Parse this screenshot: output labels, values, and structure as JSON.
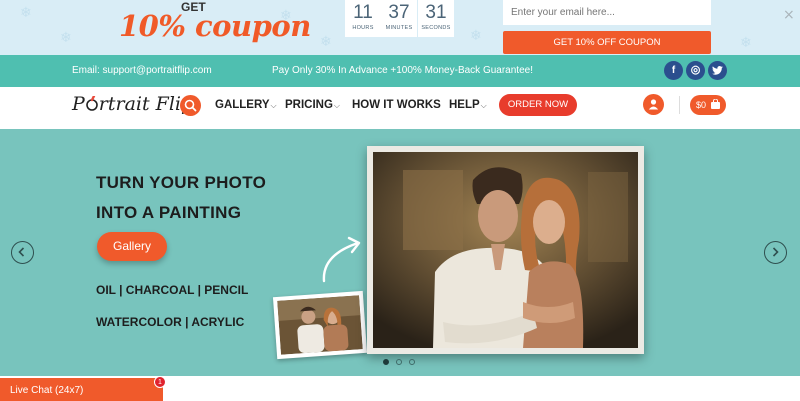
{
  "promo": {
    "get_text": "GET",
    "coupon_text": "10% coupon",
    "timer": [
      {
        "value": "11",
        "label": "HOURS"
      },
      {
        "value": "37",
        "label": "MINUTES"
      },
      {
        "value": "31",
        "label": "SECONDS"
      }
    ],
    "email_placeholder": "Enter your email here...",
    "button_label": "GET 10% OFF COUPON",
    "close_icon": "×"
  },
  "infobar": {
    "email": "Email: support@portraitflip.com",
    "message": "Pay Only 30% In Advance +100% Money-Back Guarantee!",
    "social": [
      {
        "name": "facebook-icon",
        "glyph": "f",
        "color": "#2d4f8e"
      },
      {
        "name": "instagram-icon",
        "glyph": "◎",
        "color": "#2d4f8e"
      },
      {
        "name": "twitter-icon",
        "glyph": "t",
        "color": "#2d4f8e"
      }
    ]
  },
  "nav": {
    "logo_pre": "P",
    "logo_post": "rtrait Flip",
    "links": [
      {
        "label": "GALLERY",
        "chevron": "⌵"
      },
      {
        "label": "PRICING",
        "chevron": "⌵"
      },
      {
        "label": "HOW IT WORKS",
        "chevron": ""
      },
      {
        "label": "HELP",
        "chevron": "⌵"
      }
    ],
    "order_label": "ORDER NOW",
    "cart_label": "$0"
  },
  "hero": {
    "headline_1": "TURN YOUR PHOTO",
    "headline_2": "INTO A PAINTING",
    "gallery_label": "Gallery",
    "mediums_1": "OIL | CHARCOAL | PENCIL",
    "mediums_2": "WATERCOLOR | ACRYLIC",
    "slide_index": 1,
    "slide_count": 3
  },
  "livechat": {
    "label": "Live Chat (24x7)",
    "badge": "1"
  },
  "colors": {
    "accent": "#f05a2b",
    "teal": "#4fbfb0",
    "hero_bg": "#78c4bd",
    "promo_bg": "#d9edf6"
  }
}
